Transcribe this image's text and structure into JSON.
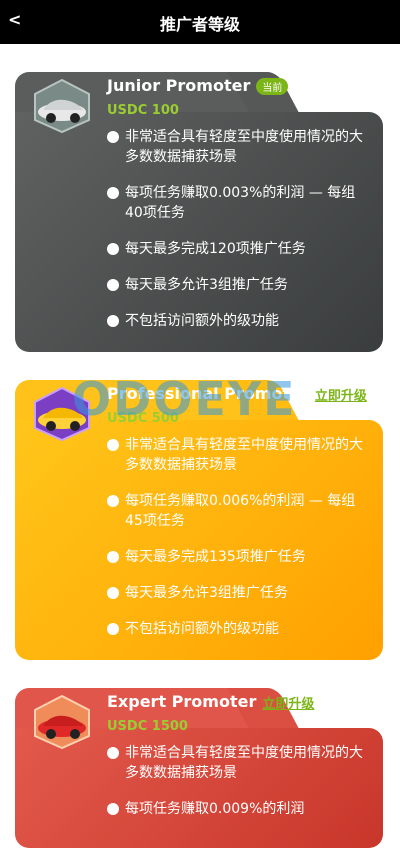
{
  "header": {
    "back": "<",
    "title": "推广者等级"
  },
  "watermark": "ODOEYE",
  "levels": [
    {
      "name": "Junior Promoter",
      "tag": "当前",
      "price": "USDC 100",
      "features": [
        "非常适合具有轻度至中度使用情况的大多数数据捕获场景",
        "每项任务赚取0.003%的利润 — 每组40项任务",
        "每天最多完成120项推广任务",
        "每天最多允许3组推广任务",
        "不包括访问额外的级功能"
      ]
    },
    {
      "name": "Professional Promoter",
      "tag": "立即升级",
      "price": "USDC 500",
      "features": [
        "非常适合具有轻度至中度使用情况的大多数数据捕获场景",
        "每项任务赚取0.006%的利润 — 每组45项任务",
        "每天最多完成135项推广任务",
        "每天最多允许3组推广任务",
        "不包括访问额外的级功能"
      ]
    },
    {
      "name": "Expert Promoter",
      "tag": "立即升级",
      "price": "USDC 1500",
      "features": [
        "非常适合具有轻度至中度使用情况的大多数数据捕获场景",
        "每项任务赚取0.009%的利润"
      ]
    }
  ],
  "colors": {
    "junior": "#4a4d4d",
    "professional": "#ffb400",
    "expert": "#d9483b",
    "accent": "#7cb518"
  }
}
